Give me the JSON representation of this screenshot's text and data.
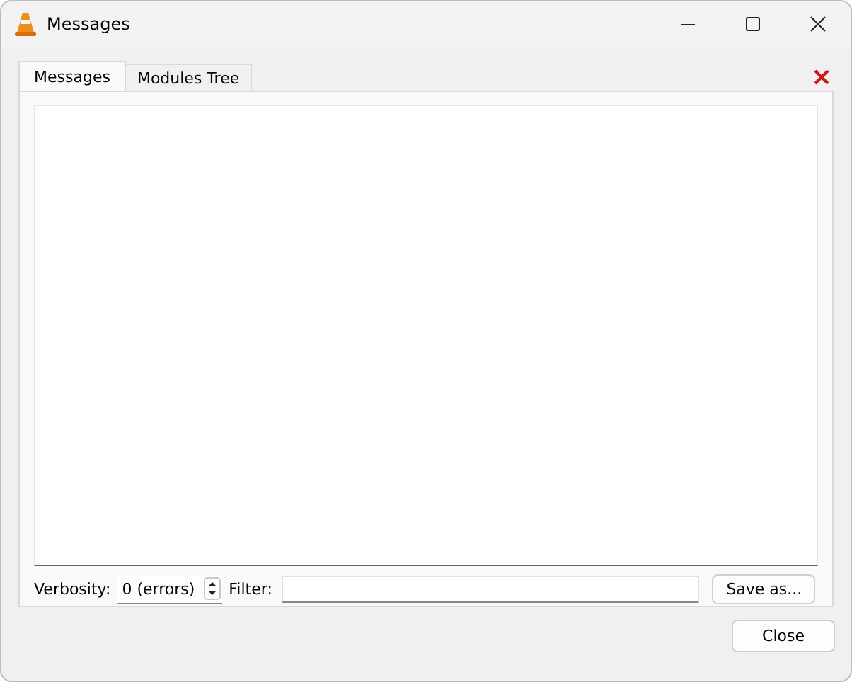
{
  "window": {
    "title": "Messages"
  },
  "tabs": [
    {
      "label": "Messages",
      "selected": true
    },
    {
      "label": "Modules Tree",
      "selected": false
    }
  ],
  "verbosity": {
    "label": "Verbosity:",
    "value": "0 (errors)"
  },
  "filter": {
    "label": "Filter:"
  },
  "save_button": "Save as...",
  "close_button": "Close"
}
